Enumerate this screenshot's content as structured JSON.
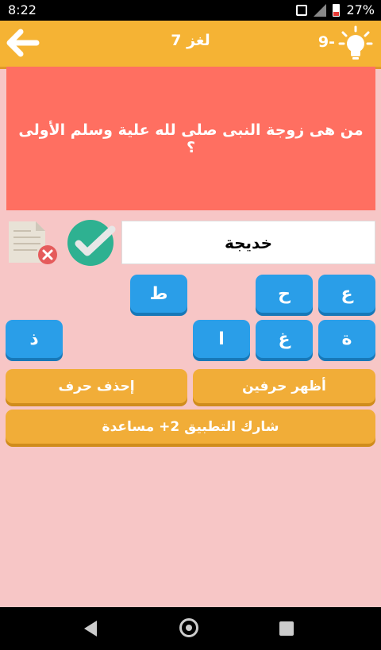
{
  "status": {
    "time": "8:22",
    "battery": "27%",
    "icons": [
      "vibrate-icon",
      "signal-icon",
      "battery-icon"
    ]
  },
  "header": {
    "title": "لغز 7",
    "hints": "9-",
    "back_icon": "arrow-left-icon",
    "hint_icon": "lightbulb-icon"
  },
  "question": "من هى زوجة النبى صلى لله علية وسلم الأولى ؟",
  "answer": "خديجة",
  "icons": {
    "delete": "document-delete-icon",
    "check": "checkmark-icon"
  },
  "letters": {
    "row1": [
      "ع",
      "ح",
      "ط"
    ],
    "row2": [
      "ة",
      "غ",
      "ا",
      "ذ"
    ]
  },
  "actions": {
    "show_two": "أظهر حرفين",
    "delete_letter": "إحذف حرف",
    "share": "شارك التطبيق 2+ مساعدة"
  },
  "colors": {
    "header": "#f5b334",
    "question_bg": "#ff6f61",
    "tile": "#2a9ee8",
    "button": "#f1ad38",
    "page_bg": "#f7c6c6"
  }
}
